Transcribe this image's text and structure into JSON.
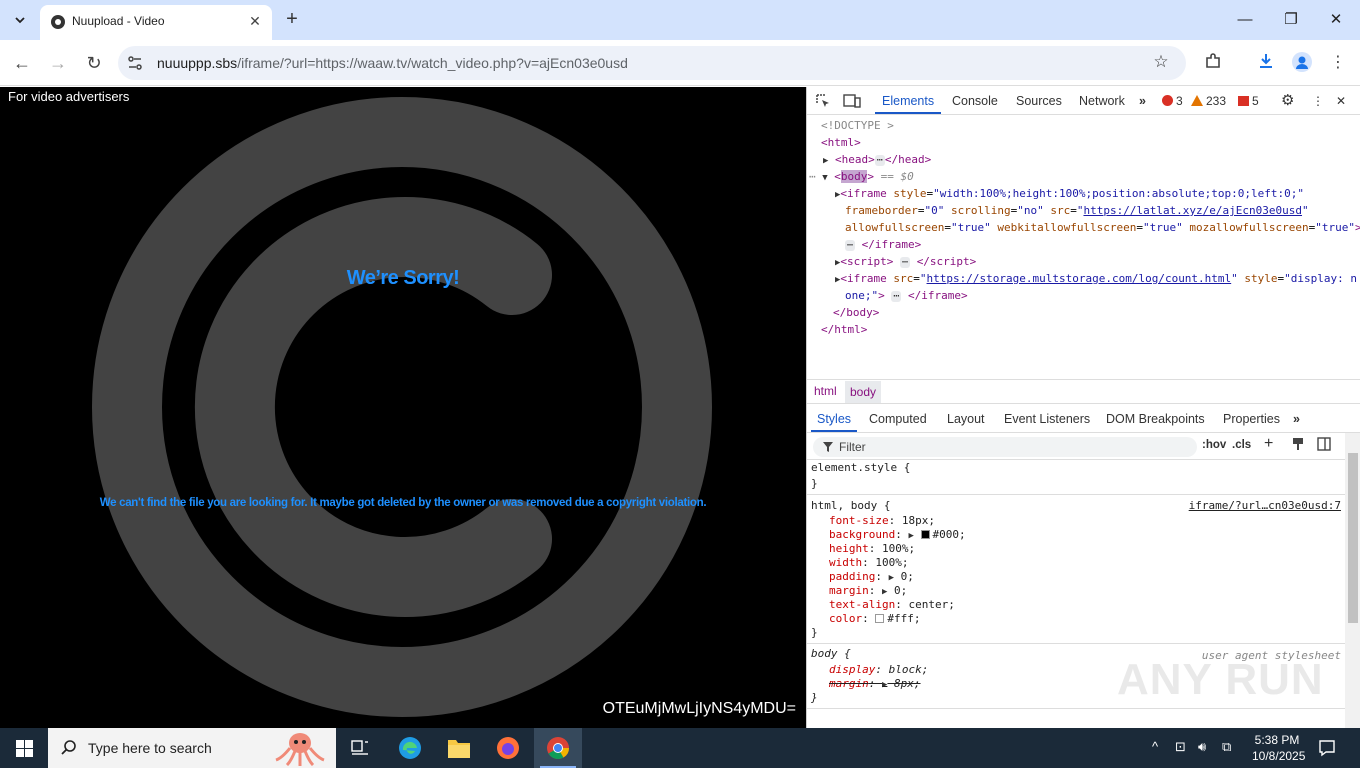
{
  "browser": {
    "tab_title": "Nuupload - Video",
    "url_host": "nuuuppp.sbs",
    "url_path": "/iframe/?url=https://waaw.tv/watch_video.php?v=ajEcn03e0usd"
  },
  "video": {
    "advertisers_link": "For video advertisers",
    "sorry_title": "We’re Sorry!",
    "sorry_message": "We can't find the file you are looking for. It maybe got deleted by the owner or was removed due a copyright violation.",
    "hash_text": "OTEuMjMwLjIyNS4yMDU="
  },
  "devtools": {
    "tabs": [
      "Elements",
      "Console",
      "Sources",
      "Network"
    ],
    "errors": "3",
    "warnings": "233",
    "issues": "5",
    "dom": {
      "doctype": "<!DOCTYPE >",
      "html_open": "<html>",
      "head_open": "<head>",
      "head_close": "</head>",
      "body_tag": "body",
      "eq0": "== $0",
      "iframe1_style_val": "width:100%;height:100%;position:absolute;top:0;left:0;",
      "iframe1_frameborder": "0",
      "iframe1_scrolling": "no",
      "iframe1_src": "https://latlat.xyz/e/ajEcn03e0usd",
      "iframe1_allowfullscreen": "true",
      "iframe1_webkit": "true",
      "iframe1_moz": "true",
      "iframe2_src": "https://storage.multstorage.com/log/count.html",
      "iframe2_style_a": "display: n",
      "iframe2_style_b": "one;",
      "body_close": "</body>",
      "html_close": "</html>"
    },
    "breadcrumbs": [
      "html",
      "body"
    ],
    "sub_tabs": [
      "Styles",
      "Computed",
      "Layout",
      "Event Listeners",
      "DOM Breakpoints",
      "Properties"
    ],
    "filter_placeholder": "Filter",
    "filter_hov": ":hov",
    "filter_cls": ".cls",
    "styles": {
      "element_style": "element.style {",
      "close_brace": "}",
      "rule1_selector": "html, body {",
      "rule1_source": "iframe/?url…cn03e0usd:7",
      "rule1_props": [
        {
          "name": "font-size",
          "value": "18px;"
        },
        {
          "name": "background",
          "value": "#000;"
        },
        {
          "name": "height",
          "value": "100%;"
        },
        {
          "name": "width",
          "value": "100%;"
        },
        {
          "name": "padding",
          "value": "0;"
        },
        {
          "name": "margin",
          "value": "0;"
        },
        {
          "name": "text-align",
          "value": "center;"
        },
        {
          "name": "color",
          "value": "#fff;"
        }
      ],
      "rule2_selector": "body {",
      "rule2_source": "user agent stylesheet",
      "rule2_display": "display",
      "rule2_display_val": "block;",
      "rule2_margin": "margin",
      "rule2_margin_val": "8px;"
    },
    "watermark": "ANY RUN"
  },
  "taskbar": {
    "search_placeholder": "Type here to search",
    "time": "5:38 PM",
    "date": "10/8/2025"
  }
}
